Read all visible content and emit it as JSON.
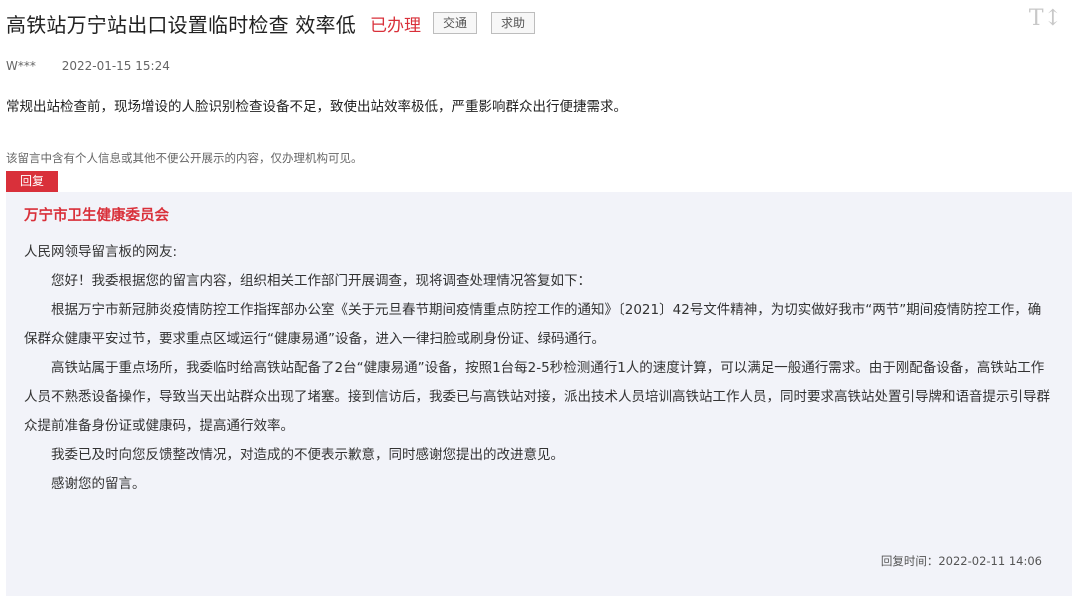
{
  "post": {
    "title": "高铁站万宁站出口设置临时检查 效率低",
    "status": "已办理",
    "tags": [
      "交通",
      "求助"
    ],
    "author": "W***",
    "date": "2022-01-15 15:24",
    "content": "常规出站检查前，现场增设的人脸识别检查设备不足，致使出站效率极低，严重影响群众出行便捷需求。",
    "privacy_notice": "该留言中含有个人信息或其他不便公开展示的内容，仅办理机构可见。"
  },
  "toolbar": {
    "font_size_label": "T↕"
  },
  "reply": {
    "tab_label": "回复",
    "organization": "万宁市卫生健康委员会",
    "greeting": "人民网领导留言板的网友:",
    "paragraphs": [
      "您好！我委根据您的留言内容，组织相关工作部门开展调查，现将调查处理情况答复如下：",
      "根据万宁市新冠肺炎疫情防控工作指挥部办公室《关于元旦春节期间疫情重点防控工作的通知》〔2021〕42号文件精神，为切实做好我市“两节”期间疫情防控工作，确保群众健康平安过节，要求重点区域运行“健康易通”设备，进入一律扫脸或刷身份证、绿码通行。",
      "高铁站属于重点场所，我委临时给高铁站配备了2台“健康易通”设备，按照1台每2-5秒检测通行1人的速度计算，可以满足一般通行需求。由于刚配备设备，高铁站工作人员不熟悉设备操作，导致当天出站群众出现了堵塞。接到信访后，我委已与高铁站对接，派出技术人员培训高铁站工作人员，同时要求高铁站处置引导牌和语音提示引导群众提前准备身份证或健康码，提高通行效率。",
      "我委已及时向您反馈整改情况，对造成的不便表示歉意，同时感谢您提出的改进意见。",
      "感谢您的留言。"
    ],
    "reply_time_label": "回复时间：",
    "reply_time": "2022-02-11 14:06"
  },
  "colors": {
    "accent_red": "#d9303a",
    "reply_background": "#f2f3f9"
  },
  "icons": {
    "font_size_toggle": "font-size-icon"
  }
}
